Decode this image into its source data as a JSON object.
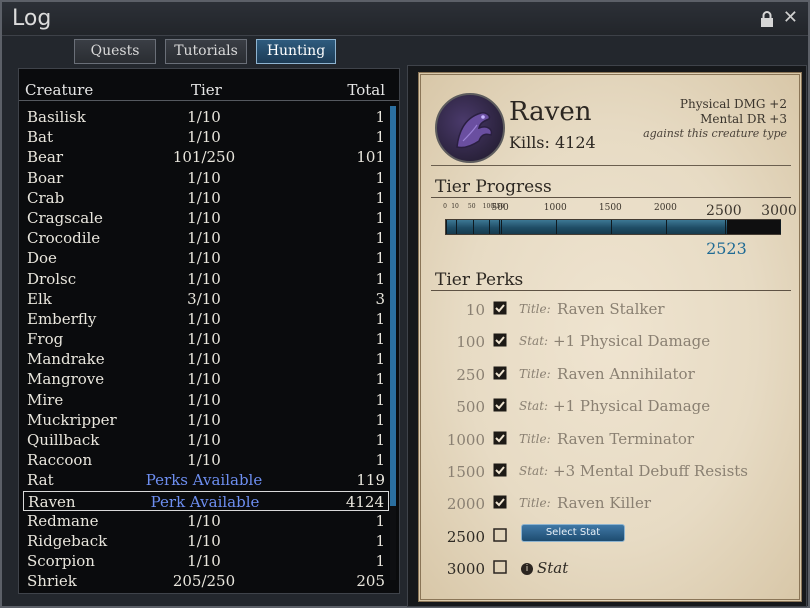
{
  "window": {
    "title": "Log"
  },
  "tabs": [
    {
      "label": "Quests",
      "active": false
    },
    {
      "label": "Tutorials",
      "active": false
    },
    {
      "label": "Hunting",
      "active": true
    }
  ],
  "list": {
    "headers": {
      "creature": "Creature",
      "tier": "Tier",
      "total": "Total"
    },
    "rows": [
      {
        "name": "Basilisk",
        "tier": "1/10",
        "total": "1"
      },
      {
        "name": "Bat",
        "tier": "1/10",
        "total": "1"
      },
      {
        "name": "Bear",
        "tier": "101/250",
        "total": "101"
      },
      {
        "name": "Boar",
        "tier": "1/10",
        "total": "1"
      },
      {
        "name": "Crab",
        "tier": "1/10",
        "total": "1"
      },
      {
        "name": "Cragscale",
        "tier": "1/10",
        "total": "1"
      },
      {
        "name": "Crocodile",
        "tier": "1/10",
        "total": "1"
      },
      {
        "name": "Doe",
        "tier": "1/10",
        "total": "1"
      },
      {
        "name": "Drolsc",
        "tier": "1/10",
        "total": "1"
      },
      {
        "name": "Elk",
        "tier": "3/10",
        "total": "3"
      },
      {
        "name": "Emberfly",
        "tier": "1/10",
        "total": "1"
      },
      {
        "name": "Frog",
        "tier": "1/10",
        "total": "1"
      },
      {
        "name": "Mandrake",
        "tier": "1/10",
        "total": "1"
      },
      {
        "name": "Mangrove",
        "tier": "1/10",
        "total": "1"
      },
      {
        "name": "Mire",
        "tier": "1/10",
        "total": "1"
      },
      {
        "name": "Muckripper",
        "tier": "1/10",
        "total": "1"
      },
      {
        "name": "Quillback",
        "tier": "1/10",
        "total": "1"
      },
      {
        "name": "Raccoon",
        "tier": "1/10",
        "total": "1"
      },
      {
        "name": "Rat",
        "tier": "Perks Available",
        "total": "119",
        "perk": true
      },
      {
        "name": "Raven",
        "tier": "Perk Available",
        "total": "4124",
        "perk": true,
        "selected": true
      },
      {
        "name": "Redmane",
        "tier": "1/10",
        "total": "1"
      },
      {
        "name": "Ridgeback",
        "tier": "1/10",
        "total": "1"
      },
      {
        "name": "Scorpion",
        "tier": "1/10",
        "total": "1"
      },
      {
        "name": "Shriek",
        "tier": "205/250",
        "total": "205"
      }
    ]
  },
  "detail": {
    "name": "Raven",
    "kills_label": "Kills:",
    "kills_value": "4124",
    "bonus_1": "Physical DMG +2",
    "bonus_2": "Mental DR +3",
    "bonus_note": "against this creature type",
    "progress_title": "Tier Progress",
    "progress_ticks": [
      "0",
      "10",
      "50",
      "100",
      "250",
      "500",
      "1000",
      "1500",
      "2000",
      "2500",
      "3000"
    ],
    "progress_max": 3000,
    "progress_value": 2523,
    "progress_value_label": "2523",
    "perks_title": "Tier Perks",
    "perks": [
      {
        "level": "10",
        "checked": true,
        "kind": "Title:",
        "text": "Raven Stalker"
      },
      {
        "level": "100",
        "checked": true,
        "kind": "Stat:",
        "text": "+1 Physical Damage"
      },
      {
        "level": "250",
        "checked": true,
        "kind": "Title:",
        "text": "Raven Annihilator"
      },
      {
        "level": "500",
        "checked": true,
        "kind": "Stat:",
        "text": "+1 Physical Damage"
      },
      {
        "level": "1000",
        "checked": true,
        "kind": "Title:",
        "text": "Raven Terminator"
      },
      {
        "level": "1500",
        "checked": true,
        "kind": "Stat:",
        "text": "+3 Mental Debuff Resists"
      },
      {
        "level": "2000",
        "checked": true,
        "kind": "Title:",
        "text": "Raven Killer"
      },
      {
        "level": "2500",
        "checked": false,
        "button": "Select Stat"
      },
      {
        "level": "3000",
        "checked": false,
        "stat_placeholder": "Stat"
      }
    ]
  },
  "colors": {
    "accent": "#2b6fa0",
    "perk_link": "#6d8ef0",
    "progress_value": "#1f6a94"
  }
}
